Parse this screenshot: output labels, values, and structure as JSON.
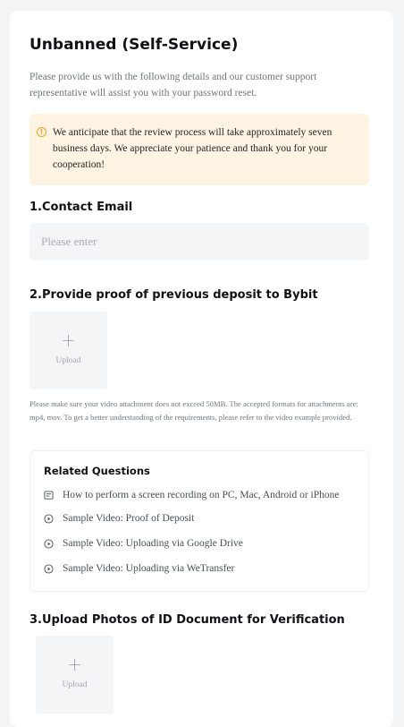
{
  "page": {
    "title": "Unbanned (Self-Service)",
    "intro": "Please provide us with the following details and our customer support representative will assist you with your password reset.",
    "notice": {
      "icon": "info-circle-icon",
      "text": "We anticipate that the review process will take approximately seven business days. We appreciate your patience and thank you for your cooperation!"
    }
  },
  "contact": {
    "heading": "1.Contact Email",
    "placeholder": "Please enter",
    "value": ""
  },
  "deposit": {
    "heading": "2.Provide proof of previous deposit to Bybit",
    "upload_label": "Upload",
    "note": "Please make sure your video attachment does not exceed 50MB. The accepted formats for attachments are: mp4, mov. To get a better understanding of the requirements, please refer to the video example provided."
  },
  "related": {
    "title": "Related Questions",
    "items": [
      {
        "label": "How to perform a screen recording on PC, Mac, Android or iPhone",
        "icon": "article-icon"
      },
      {
        "label": "Sample Video: Proof of Deposit",
        "icon": "play-circle-icon"
      },
      {
        "label": "Sample Video: Uploading via Google Drive",
        "icon": "play-circle-icon"
      },
      {
        "label": "Sample Video: Uploading via WeTransfer",
        "icon": "play-circle-icon"
      }
    ]
  },
  "id_document": {
    "heading": "3.Upload Photos of ID Document for Verification",
    "upload_label": "Upload"
  },
  "colors": {
    "notice_bg": "#fff4e3",
    "notice_icon": "#f0a21a",
    "input_bg": "#f4f5f7",
    "muted_text": "#71757a"
  }
}
